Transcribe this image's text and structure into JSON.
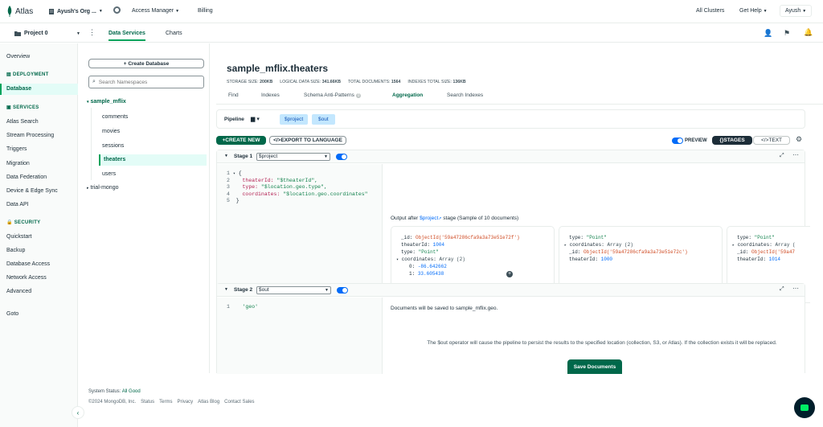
{
  "topbar": {
    "brand": "Atlas",
    "org": "Ayush's Org ...",
    "access_manager": "Access Manager",
    "billing": "Billing",
    "all_clusters": "All Clusters",
    "get_help": "Get Help",
    "user": "Ayush"
  },
  "subbar": {
    "project": "Project 0",
    "tabs": [
      "Data Services",
      "Charts"
    ]
  },
  "sidebar": {
    "overview": "Overview",
    "deployment_header": "DEPLOYMENT",
    "database": "Database",
    "services_header": "SERVICES",
    "services": [
      "Atlas Search",
      "Stream Processing",
      "Triggers",
      "Migration",
      "Data Federation",
      "Device & Edge Sync",
      "Data API"
    ],
    "security_header": "SECURITY",
    "security": [
      "Quickstart",
      "Backup",
      "Database Access",
      "Network Access",
      "Advanced"
    ],
    "goto": "Goto"
  },
  "namespace": {
    "create_db": "+ Create Database",
    "search_placeholder": "Search Namespaces",
    "db": "sample_mflix",
    "collections": [
      "comments",
      "movies",
      "sessions",
      "theaters",
      "users"
    ],
    "other_db": "trial-mongo"
  },
  "collection": {
    "title": "sample_mflix.theaters",
    "stats": [
      {
        "label": "STORAGE SIZE:",
        "value": "200KB"
      },
      {
        "label": "LOGICAL DATA SIZE:",
        "value": "341.66KB"
      },
      {
        "label": "TOTAL DOCUMENTS:",
        "value": "1564"
      },
      {
        "label": "INDEXES TOTAL SIZE:",
        "value": "136KB"
      }
    ],
    "tabs": [
      "Find",
      "Indexes",
      "Schema Anti-Patterns",
      "Aggregation",
      "Search Indexes"
    ],
    "schema_badge": "0"
  },
  "pipeline": {
    "label": "Pipeline",
    "chips": [
      "$project",
      "$out"
    ],
    "create_new": "CREATE NEW",
    "export": "EXPORT TO LANGUAGE",
    "preview": "PREVIEW",
    "stages_btn": "STAGES",
    "text_btn": "TEXT"
  },
  "stage1": {
    "label": "Stage 1",
    "operator": "$project",
    "code": [
      {
        "n": "1",
        "t": "{"
      },
      {
        "n": "2",
        "k": "theaterId:",
        "v": " \"$theaterId\","
      },
      {
        "n": "3",
        "k": "type:",
        "v": " \"$location.geo.type\","
      },
      {
        "n": "4",
        "k": "coordinates:",
        "v": " \"$location.geo.coordinates\""
      },
      {
        "n": "5",
        "t": "}"
      }
    ],
    "output_prefix": "Output after",
    "output_op": "$project",
    "output_suffix": "stage (Sample of 10 documents)",
    "docs": [
      [
        {
          "k": "_id:",
          "v": "ObjectId('59a47286cfa9a3a73e51e72f')",
          "c": "oid"
        },
        {
          "k": "theaterId:",
          "v": "1004",
          "c": "num"
        },
        {
          "k": "type:",
          "v": "\"Point\"",
          "c": "str"
        },
        {
          "k": "coordinates:",
          "v": "Array (2)",
          "c": "n",
          "arrow": true
        },
        {
          "k": "0:",
          "v": "-86.642662",
          "c": "num",
          "indent": true
        },
        {
          "k": "1:",
          "v": "33.605438",
          "c": "num",
          "indent": true
        }
      ],
      [
        {
          "k": "type:",
          "v": "\"Point\"",
          "c": "str"
        },
        {
          "k": "coordinates:",
          "v": "Array (2)",
          "c": "n",
          "arrow": true
        },
        {
          "k": "_id:",
          "v": "ObjectId('59a47286cfa9a3a73e51e72c')",
          "c": "oid"
        },
        {
          "k": "theaterId:",
          "v": "1000",
          "c": "num"
        }
      ],
      [
        {
          "k": "type:",
          "v": "\"Point\"",
          "c": "str"
        },
        {
          "k": "coordinates:",
          "v": "Array (",
          "c": "n",
          "arrow": true
        },
        {
          "k": "_id:",
          "v": "ObjectId('59a47",
          "c": "oid"
        },
        {
          "k": "theaterId:",
          "v": "1014",
          "c": "num"
        }
      ]
    ]
  },
  "stage2": {
    "label": "Stage 2",
    "operator": "$out",
    "code_line_num": "1",
    "code_value": "'geo'",
    "saved_note": "Documents will be saved to sample_mflix.geo.",
    "warning": "The $out operator will cause the pipeline to persist the results to the specified location (collection, S3, or Atlas). If the collection exists it will be replaced.",
    "save_btn": "Save Documents"
  },
  "footer": {
    "status_label": "System Status:",
    "status_value": "All Good",
    "copyright": "©2024 MongoDB, Inc.",
    "links": [
      "Status",
      "Terms",
      "Privacy",
      "Atlas Blog",
      "Contact Sales"
    ]
  },
  "colors": {
    "brand_green": "#00684a",
    "link_blue": "#016bf8",
    "button_green": "#00684a"
  }
}
